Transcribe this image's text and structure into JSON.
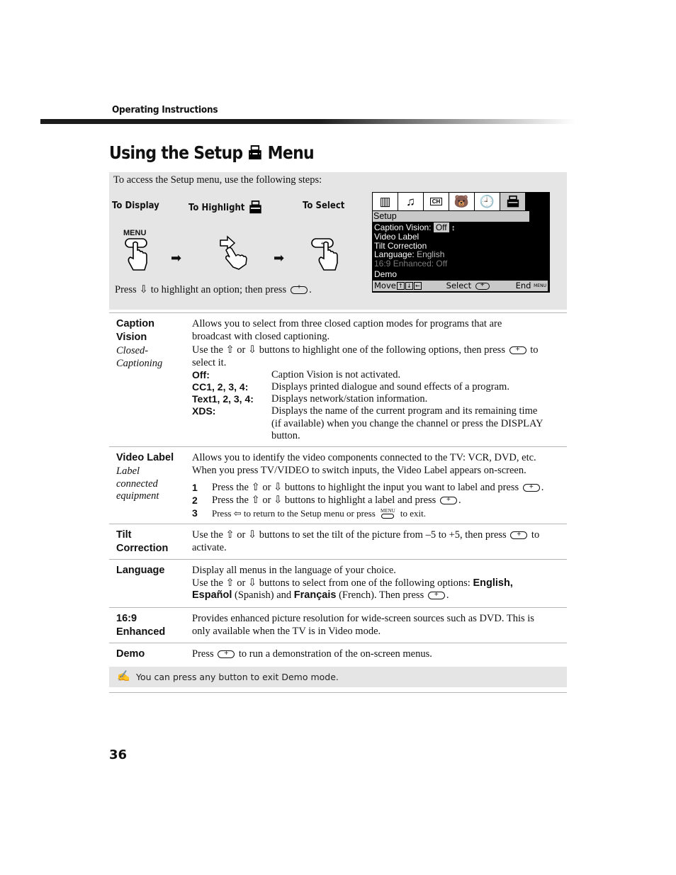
{
  "header": {
    "section_label": "Operating Instructions"
  },
  "title": {
    "before_icon": "Using the Setup",
    "icon": "setup-toolbox-icon",
    "after_icon": "Menu"
  },
  "steps": {
    "intro": "To access the Setup menu, use the following steps:",
    "labels": [
      "To Display",
      "To Highlight",
      "To Select"
    ],
    "menu_button_label": "MENU",
    "press_before": "Press",
    "press_middle": "to highlight an option; then press",
    "press_end": "."
  },
  "tv_menu": {
    "icons": [
      "video-icon",
      "audio-icon",
      "channel-icon",
      "parent-icon",
      "timer-icon",
      "setup-icon"
    ],
    "ch_label": "CH",
    "title": "Setup",
    "items": [
      {
        "label": "Caption Vision:",
        "value": "Off"
      },
      {
        "label": "Video Label",
        "value": ""
      },
      {
        "label": "Tilt Correction",
        "value": ""
      },
      {
        "label": "Language:",
        "value": "English"
      },
      {
        "label": "16:9 Enhanced: Off",
        "value": ""
      },
      {
        "label": "Demo",
        "value": ""
      }
    ],
    "bottom": {
      "move": "Move",
      "select": "Select",
      "end": "End",
      "menu_small": "MENU"
    }
  },
  "definitions": {
    "caption_vision": {
      "term": "Caption Vision",
      "term_line1": "Caption",
      "term_line2": "Vision",
      "sub_line1": "Closed-",
      "sub_line2": "Captioning",
      "desc1_line1": "Allows you to select from three closed caption modes for programs that are",
      "desc1_line2": "broadcast with closed captioning.",
      "desc2_a": "Use the",
      "desc2_or": "or",
      "desc2_b": "buttons to highlight one of the following options, then press",
      "desc2_c": "to",
      "desc2_line2": "select it.",
      "options": [
        {
          "key": "Off:",
          "lines": [
            "Caption Vision is not activated."
          ]
        },
        {
          "key": "CC1, 2, 3, 4:",
          "lines": [
            "Displays printed dialogue and sound effects of a program."
          ]
        },
        {
          "key": "Text1, 2, 3, 4:",
          "lines": [
            "Displays network/station information."
          ]
        },
        {
          "key": "XDS:",
          "lines": [
            "Displays the name of the current program and its remaining time",
            "(if available) when you change the channel or press the DISPLAY",
            "button."
          ]
        }
      ]
    },
    "video_label": {
      "term": "Video Label",
      "sub_line1": "Label",
      "sub_line2": "connected",
      "sub_line3": "equipment",
      "desc_line1": "Allows you to identify the video components connected to the TV: VCR, DVD, etc.",
      "desc_line2": "When you press TV/VIDEO to switch inputs, the Video Label appears on-screen.",
      "steps": [
        {
          "num": "1",
          "a": "Press the",
          "or": "or",
          "b": "buttons to highlight the input you want to label and press",
          "end": "."
        },
        {
          "num": "2",
          "a": "Press the",
          "or": "or",
          "b": "buttons to highlight a label and press",
          "end": "."
        },
        {
          "num": "3",
          "a": "Press",
          "b": "to return to the Setup menu or press",
          "menu": "MENU",
          "end": "to exit."
        }
      ]
    },
    "tilt": {
      "term_line1": "Tilt",
      "term_line2": "Correction",
      "a": "Use the",
      "or": "or",
      "b": "buttons to set the tilt of the picture from –5 to +5, then press",
      "c": "to",
      "line2": "activate."
    },
    "language": {
      "term": "Language",
      "line1": "Display all menus in the language of your choice.",
      "a": "Use the",
      "or": "or",
      "b": "buttons to select from one of the following options:",
      "opt1": "English,",
      "opt2": "Español",
      "opt2_note": "(Spanish) and",
      "opt3": "Français",
      "opt3_note": "(French). Then press",
      "end": "."
    },
    "enhanced": {
      "term_line1": "16:9",
      "term_line2": "Enhanced",
      "line1": "Provides enhanced picture resolution for wide-screen sources such as DVD. This is",
      "line2": "only available when the TV is in Video mode."
    },
    "demo": {
      "term": "Demo",
      "a": "Press",
      "b": "to run a demonstration of the on-screen menus."
    }
  },
  "note": {
    "icon": "note-pencil-icon",
    "text": "You can press any button to exit Demo mode."
  },
  "page_number": "36"
}
